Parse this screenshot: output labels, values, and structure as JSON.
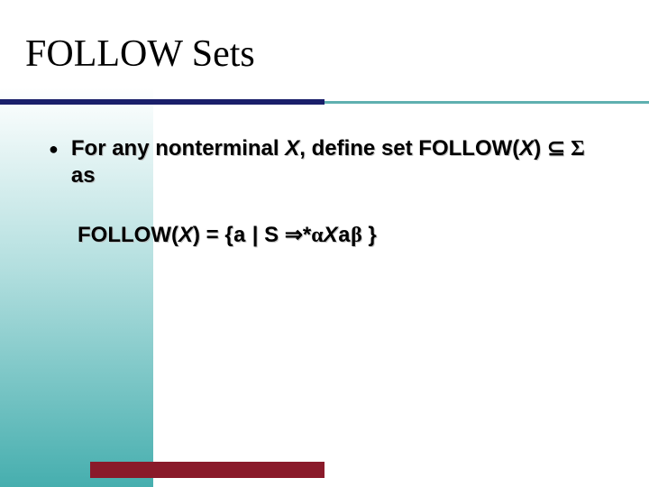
{
  "title": "FOLLOW Sets",
  "bullet": {
    "part1": "For any nonterminal ",
    "X": "X",
    "part2": ", define set FOLLOW(",
    "X2": "X",
    "part3": ") ",
    "subset": "⊆",
    "sigma": " Σ ",
    "part4": "as"
  },
  "formula": {
    "lhs1": "FOLLOW(",
    "X": "X",
    "lhs2": ") = {",
    "a1": "a",
    "mid": " | S ",
    "arrow": "⇒",
    "star": "*",
    "alpha": "α",
    "X2": "X",
    "a2": "a",
    "beta": "β",
    "rhs": " }"
  }
}
